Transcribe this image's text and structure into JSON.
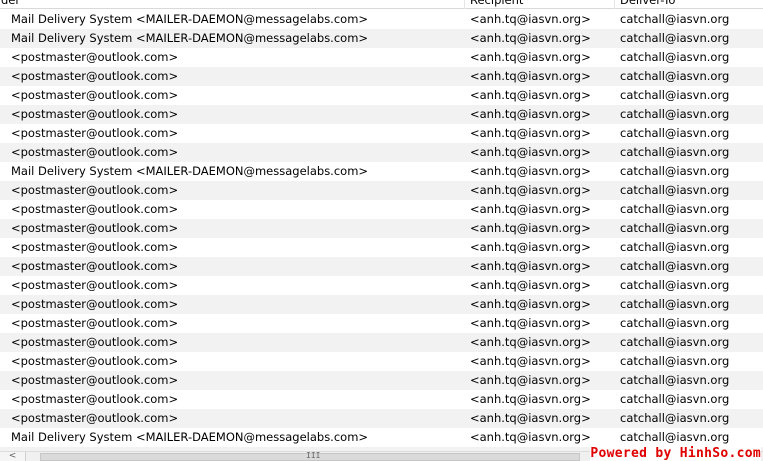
{
  "table": {
    "columns": [
      "der",
      "Recipient",
      "Deliver-To"
    ],
    "rows": [
      [
        "Mail Delivery System <MAILER-DAEMON@messagelabs.com>",
        "<anh.tq@iasvn.org>",
        "catchall@iasvn.org"
      ],
      [
        "Mail Delivery System <MAILER-DAEMON@messagelabs.com>",
        "<anh.tq@iasvn.org>",
        "catchall@iasvn.org"
      ],
      [
        "<postmaster@outlook.com>",
        "<anh.tq@iasvn.org>",
        "catchall@iasvn.org"
      ],
      [
        "<postmaster@outlook.com>",
        "<anh.tq@iasvn.org>",
        "catchall@iasvn.org"
      ],
      [
        "<postmaster@outlook.com>",
        "<anh.tq@iasvn.org>",
        "catchall@iasvn.org"
      ],
      [
        "<postmaster@outlook.com>",
        "<anh.tq@iasvn.org>",
        "catchall@iasvn.org"
      ],
      [
        "<postmaster@outlook.com>",
        "<anh.tq@iasvn.org>",
        "catchall@iasvn.org"
      ],
      [
        "<postmaster@outlook.com>",
        "<anh.tq@iasvn.org>",
        "catchall@iasvn.org"
      ],
      [
        "Mail Delivery System <MAILER-DAEMON@messagelabs.com>",
        "<anh.tq@iasvn.org>",
        "catchall@iasvn.org"
      ],
      [
        "<postmaster@outlook.com>",
        "<anh.tq@iasvn.org>",
        "catchall@iasvn.org"
      ],
      [
        "<postmaster@outlook.com>",
        "<anh.tq@iasvn.org>",
        "catchall@iasvn.org"
      ],
      [
        "<postmaster@outlook.com>",
        "<anh.tq@iasvn.org>",
        "catchall@iasvn.org"
      ],
      [
        "<postmaster@outlook.com>",
        "<anh.tq@iasvn.org>",
        "catchall@iasvn.org"
      ],
      [
        "<postmaster@outlook.com>",
        "<anh.tq@iasvn.org>",
        "catchall@iasvn.org"
      ],
      [
        "<postmaster@outlook.com>",
        "<anh.tq@iasvn.org>",
        "catchall@iasvn.org"
      ],
      [
        "<postmaster@outlook.com>",
        "<anh.tq@iasvn.org>",
        "catchall@iasvn.org"
      ],
      [
        "<postmaster@outlook.com>",
        "<anh.tq@iasvn.org>",
        "catchall@iasvn.org"
      ],
      [
        "<postmaster@outlook.com>",
        "<anh.tq@iasvn.org>",
        "catchall@iasvn.org"
      ],
      [
        "<postmaster@outlook.com>",
        "<anh.tq@iasvn.org>",
        "catchall@iasvn.org"
      ],
      [
        "<postmaster@outlook.com>",
        "<anh.tq@iasvn.org>",
        "catchall@iasvn.org"
      ],
      [
        "<postmaster@outlook.com>",
        "<anh.tq@iasvn.org>",
        "catchall@iasvn.org"
      ],
      [
        "<postmaster@outlook.com>",
        "<anh.tq@iasvn.org>",
        "catchall@iasvn.org"
      ],
      [
        "Mail Delivery System <MAILER-DAEMON@messagelabs.com>",
        "<anh.tq@iasvn.org>",
        "catchall@iasvn.org"
      ],
      [
        "Mail Delivery System <MAILER-DAEMON@messagelabs.com>",
        "<anh.tq@iasvn.org>",
        "catchall@iasvn.org"
      ]
    ]
  },
  "scrollbar": {
    "left_arrow_icon": "chevron-left-icon",
    "left_arrow_glyph": "<",
    "grip_glyph": "III"
  },
  "watermark": {
    "text": "Powered by HinhSo.com",
    "color": "#e00000"
  },
  "colors": {
    "row_alt": "#f2f2f2",
    "row": "#ffffff"
  }
}
